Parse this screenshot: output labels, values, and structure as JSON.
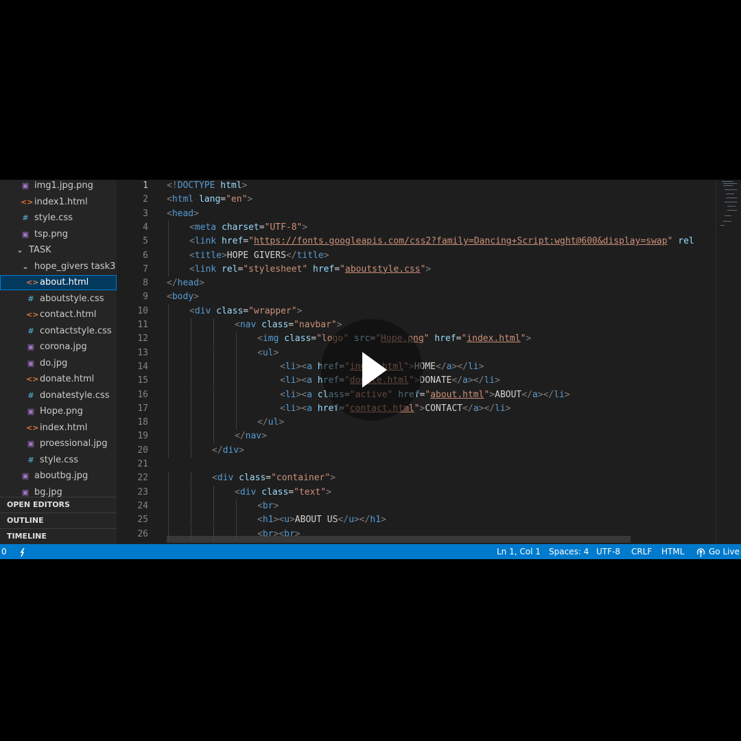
{
  "explorer": {
    "items": [
      {
        "icon": "image-file-icon",
        "kind": "img",
        "label": "img1.jpg.png",
        "indent": 30
      },
      {
        "icon": "html-file-icon",
        "kind": "html",
        "label": "index1.html",
        "indent": 30
      },
      {
        "icon": "css-file-icon",
        "kind": "css",
        "label": "style.css",
        "indent": 30
      },
      {
        "icon": "image-file-icon",
        "kind": "img",
        "label": "tsp.png",
        "indent": 30
      },
      {
        "icon": "chevron-down-icon",
        "kind": "chev",
        "label": "TASK",
        "indent": 22
      },
      {
        "icon": "chevron-down-icon",
        "kind": "chev",
        "label": "hope_givers task3",
        "indent": 30
      },
      {
        "icon": "html-file-icon",
        "kind": "html",
        "label": "about.html",
        "indent": 38,
        "active": true
      },
      {
        "icon": "css-file-icon",
        "kind": "css",
        "label": "aboutstyle.css",
        "indent": 38
      },
      {
        "icon": "html-file-icon",
        "kind": "html",
        "label": "contact.html",
        "indent": 38
      },
      {
        "icon": "css-file-icon",
        "kind": "css",
        "label": "contactstyle.css",
        "indent": 38
      },
      {
        "icon": "image-file-icon",
        "kind": "img",
        "label": "corona.jpg",
        "indent": 38
      },
      {
        "icon": "image-file-icon",
        "kind": "img",
        "label": "do.jpg",
        "indent": 38
      },
      {
        "icon": "html-file-icon",
        "kind": "html",
        "label": "donate.html",
        "indent": 38
      },
      {
        "icon": "css-file-icon",
        "kind": "css",
        "label": "donatestyle.css",
        "indent": 38
      },
      {
        "icon": "image-file-icon",
        "kind": "img",
        "label": "Hope.png",
        "indent": 38
      },
      {
        "icon": "html-file-icon",
        "kind": "html",
        "label": "index.html",
        "indent": 38
      },
      {
        "icon": "image-file-icon",
        "kind": "img",
        "label": "proessional.jpg",
        "indent": 38
      },
      {
        "icon": "css-file-icon",
        "kind": "css",
        "label": "style.css",
        "indent": 38
      },
      {
        "icon": "image-file-icon",
        "kind": "img",
        "label": "aboutbg.jpg",
        "indent": 30
      },
      {
        "icon": "image-file-icon",
        "kind": "img",
        "label": "bg.jpg",
        "indent": 30
      }
    ],
    "sections": [
      "OPEN EDITORS",
      "OUTLINE",
      "TIMELINE"
    ]
  },
  "editor": {
    "current_line": 1,
    "lines": [
      {
        "n": "1",
        "indent": 0,
        "tokens": [
          [
            "p",
            "<!"
          ],
          [
            "t",
            "DOCTYPE"
          ],
          [
            "x",
            " "
          ],
          [
            "a",
            "html"
          ],
          [
            "p",
            ">"
          ]
        ]
      },
      {
        "n": "2",
        "indent": 0,
        "tokens": [
          [
            "p",
            "<"
          ],
          [
            "t",
            "html"
          ],
          [
            "x",
            " "
          ],
          [
            "a",
            "lang"
          ],
          [
            "x",
            "="
          ],
          [
            "s",
            "\"en\""
          ],
          [
            "p",
            ">"
          ]
        ]
      },
      {
        "n": "3",
        "indent": 0,
        "tokens": [
          [
            "p",
            "<"
          ],
          [
            "t",
            "head"
          ],
          [
            "p",
            ">"
          ]
        ]
      },
      {
        "n": "4",
        "indent": 1,
        "tokens": [
          [
            "p",
            "<"
          ],
          [
            "t",
            "meta"
          ],
          [
            "x",
            " "
          ],
          [
            "a",
            "charset"
          ],
          [
            "x",
            "="
          ],
          [
            "s",
            "\"UTF-8\""
          ],
          [
            "p",
            ">"
          ]
        ]
      },
      {
        "n": "5",
        "indent": 1,
        "tokens": [
          [
            "p",
            "<"
          ],
          [
            "t",
            "link"
          ],
          [
            "x",
            " "
          ],
          [
            "a",
            "href"
          ],
          [
            "x",
            "="
          ],
          [
            "s",
            "\""
          ],
          [
            "u",
            "https://fonts.googleapis.com/css2?family=Dancing+Script:wght@600&display=swap"
          ],
          [
            "s",
            "\""
          ],
          [
            "x",
            " "
          ],
          [
            "a",
            "rel"
          ]
        ]
      },
      {
        "n": "6",
        "indent": 1,
        "tokens": [
          [
            "p",
            "<"
          ],
          [
            "t",
            "title"
          ],
          [
            "p",
            ">"
          ],
          [
            "x",
            "HOPE GIVERS"
          ],
          [
            "p",
            "</"
          ],
          [
            "t",
            "title"
          ],
          [
            "p",
            ">"
          ]
        ]
      },
      {
        "n": "7",
        "indent": 1,
        "tokens": [
          [
            "p",
            "<"
          ],
          [
            "t",
            "link"
          ],
          [
            "x",
            " "
          ],
          [
            "a",
            "rel"
          ],
          [
            "x",
            "="
          ],
          [
            "s",
            "\"stylesheet\""
          ],
          [
            "x",
            " "
          ],
          [
            "a",
            "href"
          ],
          [
            "x",
            "="
          ],
          [
            "s",
            "\""
          ],
          [
            "u",
            "aboutstyle.css"
          ],
          [
            "s",
            "\""
          ],
          [
            "p",
            ">"
          ]
        ]
      },
      {
        "n": "8",
        "indent": 0,
        "tokens": [
          [
            "p",
            "</"
          ],
          [
            "t",
            "head"
          ],
          [
            "p",
            ">"
          ]
        ]
      },
      {
        "n": "9",
        "indent": 0,
        "tokens": [
          [
            "p",
            "<"
          ],
          [
            "t",
            "body"
          ],
          [
            "p",
            ">"
          ]
        ]
      },
      {
        "n": "10",
        "indent": 1,
        "tokens": [
          [
            "p",
            "<"
          ],
          [
            "t",
            "div"
          ],
          [
            "x",
            " "
          ],
          [
            "a",
            "class"
          ],
          [
            "x",
            "="
          ],
          [
            "s",
            "\"wrapper\""
          ],
          [
            "p",
            ">"
          ]
        ]
      },
      {
        "n": "11",
        "indent": 3,
        "tokens": [
          [
            "p",
            "<"
          ],
          [
            "t",
            "nav"
          ],
          [
            "x",
            " "
          ],
          [
            "a",
            "class"
          ],
          [
            "x",
            "="
          ],
          [
            "s",
            "\"navbar\""
          ],
          [
            "p",
            ">"
          ]
        ]
      },
      {
        "n": "12",
        "indent": 4,
        "tokens": [
          [
            "p",
            "<"
          ],
          [
            "t",
            "img"
          ],
          [
            "x",
            " "
          ],
          [
            "a",
            "class"
          ],
          [
            "x",
            "="
          ],
          [
            "s",
            "\"logo\""
          ],
          [
            "x",
            " "
          ],
          [
            "a",
            "src"
          ],
          [
            "x",
            "="
          ],
          [
            "s",
            "\""
          ],
          [
            "u",
            "Hope.png"
          ],
          [
            "s",
            "\""
          ],
          [
            "x",
            " "
          ],
          [
            "a",
            "href"
          ],
          [
            "x",
            "="
          ],
          [
            "s",
            "\""
          ],
          [
            "u",
            "index.html"
          ],
          [
            "s",
            "\""
          ],
          [
            "p",
            ">"
          ]
        ]
      },
      {
        "n": "13",
        "indent": 4,
        "tokens": [
          [
            "p",
            "<"
          ],
          [
            "t",
            "ul"
          ],
          [
            "p",
            ">"
          ]
        ]
      },
      {
        "n": "14",
        "indent": 5,
        "tokens": [
          [
            "p",
            "<"
          ],
          [
            "t",
            "li"
          ],
          [
            "p",
            "><"
          ],
          [
            "t",
            "a"
          ],
          [
            "x",
            " "
          ],
          [
            "a",
            "href"
          ],
          [
            "x",
            "="
          ],
          [
            "s",
            "\""
          ],
          [
            "u",
            "index.html"
          ],
          [
            "s",
            "\""
          ],
          [
            "p",
            ">"
          ],
          [
            "x",
            "HOME"
          ],
          [
            "p",
            "</"
          ],
          [
            "t",
            "a"
          ],
          [
            "p",
            "></"
          ],
          [
            "t",
            "li"
          ],
          [
            "p",
            ">"
          ]
        ]
      },
      {
        "n": "15",
        "indent": 5,
        "tokens": [
          [
            "p",
            "<"
          ],
          [
            "t",
            "li"
          ],
          [
            "p",
            "><"
          ],
          [
            "t",
            "a"
          ],
          [
            "x",
            " "
          ],
          [
            "a",
            "href"
          ],
          [
            "x",
            "="
          ],
          [
            "s",
            "\""
          ],
          [
            "u",
            "donate.html"
          ],
          [
            "s",
            "\""
          ],
          [
            "p",
            ">"
          ],
          [
            "x",
            "DONATE"
          ],
          [
            "p",
            "</"
          ],
          [
            "t",
            "a"
          ],
          [
            "p",
            "></"
          ],
          [
            "t",
            "li"
          ],
          [
            "p",
            ">"
          ]
        ]
      },
      {
        "n": "16",
        "indent": 5,
        "tokens": [
          [
            "p",
            "<"
          ],
          [
            "t",
            "li"
          ],
          [
            "p",
            "><"
          ],
          [
            "t",
            "a"
          ],
          [
            "x",
            " "
          ],
          [
            "a",
            "class"
          ],
          [
            "x",
            "="
          ],
          [
            "s",
            "\"active\""
          ],
          [
            "x",
            " "
          ],
          [
            "a",
            "href"
          ],
          [
            "x",
            "="
          ],
          [
            "s",
            "\""
          ],
          [
            "u",
            "about.html"
          ],
          [
            "s",
            "\""
          ],
          [
            "p",
            ">"
          ],
          [
            "x",
            "ABOUT"
          ],
          [
            "p",
            "</"
          ],
          [
            "t",
            "a"
          ],
          [
            "p",
            "></"
          ],
          [
            "t",
            "li"
          ],
          [
            "p",
            ">"
          ]
        ]
      },
      {
        "n": "17",
        "indent": 5,
        "tokens": [
          [
            "p",
            "<"
          ],
          [
            "t",
            "li"
          ],
          [
            "p",
            "><"
          ],
          [
            "t",
            "a"
          ],
          [
            "x",
            " "
          ],
          [
            "a",
            "href"
          ],
          [
            "x",
            "="
          ],
          [
            "s",
            "\""
          ],
          [
            "u",
            "contact.html"
          ],
          [
            "s",
            "\""
          ],
          [
            "p",
            ">"
          ],
          [
            "x",
            "CONTACT"
          ],
          [
            "p",
            "</"
          ],
          [
            "t",
            "a"
          ],
          [
            "p",
            "></"
          ],
          [
            "t",
            "li"
          ],
          [
            "p",
            ">"
          ]
        ]
      },
      {
        "n": "18",
        "indent": 4,
        "tokens": [
          [
            "p",
            "</"
          ],
          [
            "t",
            "ul"
          ],
          [
            "p",
            ">"
          ]
        ]
      },
      {
        "n": "19",
        "indent": 3,
        "tokens": [
          [
            "p",
            "</"
          ],
          [
            "t",
            "nav"
          ],
          [
            "p",
            ">"
          ]
        ]
      },
      {
        "n": "20",
        "indent": 2,
        "tokens": [
          [
            "p",
            "</"
          ],
          [
            "t",
            "div"
          ],
          [
            "p",
            ">"
          ]
        ]
      },
      {
        "n": "21",
        "indent": 0,
        "tokens": []
      },
      {
        "n": "22",
        "indent": 2,
        "tokens": [
          [
            "p",
            "<"
          ],
          [
            "t",
            "div"
          ],
          [
            "x",
            " "
          ],
          [
            "a",
            "class"
          ],
          [
            "x",
            "="
          ],
          [
            "s",
            "\"container\""
          ],
          [
            "p",
            ">"
          ]
        ]
      },
      {
        "n": "23",
        "indent": 3,
        "tokens": [
          [
            "p",
            "<"
          ],
          [
            "t",
            "div"
          ],
          [
            "x",
            " "
          ],
          [
            "a",
            "class"
          ],
          [
            "x",
            "="
          ],
          [
            "s",
            "\"text\""
          ],
          [
            "p",
            ">"
          ]
        ]
      },
      {
        "n": "24",
        "indent": 4,
        "tokens": [
          [
            "p",
            "<"
          ],
          [
            "t",
            "br"
          ],
          [
            "p",
            ">"
          ]
        ]
      },
      {
        "n": "25",
        "indent": 4,
        "tokens": [
          [
            "p",
            "<"
          ],
          [
            "t",
            "h1"
          ],
          [
            "p",
            "><"
          ],
          [
            "t",
            "u"
          ],
          [
            "p",
            ">"
          ],
          [
            "x",
            "ABOUT US"
          ],
          [
            "p",
            "</"
          ],
          [
            "t",
            "u"
          ],
          [
            "p",
            "></"
          ],
          [
            "t",
            "h1"
          ],
          [
            "p",
            ">"
          ]
        ]
      },
      {
        "n": "26",
        "indent": 4,
        "tokens": [
          [
            "p",
            "<"
          ],
          [
            "t",
            "br"
          ],
          [
            "p",
            "><"
          ],
          [
            "t",
            "br"
          ],
          [
            "p",
            ">"
          ]
        ]
      }
    ]
  },
  "statusbar": {
    "left": "0",
    "branch_icon": "sync-icon",
    "position": "Ln 1, Col 1",
    "spaces": "Spaces: 4",
    "encoding": "UTF-8",
    "eol": "CRLF",
    "language": "HTML",
    "go_live": "Go Live",
    "go_live_icon": "broadcast-icon"
  },
  "overlay": {
    "icon": "play-icon"
  },
  "colors": {
    "statusbar": "#007acc",
    "editor_bg": "#1e1e1e",
    "sidebar_bg": "#252526",
    "accent": "#007fd4"
  }
}
